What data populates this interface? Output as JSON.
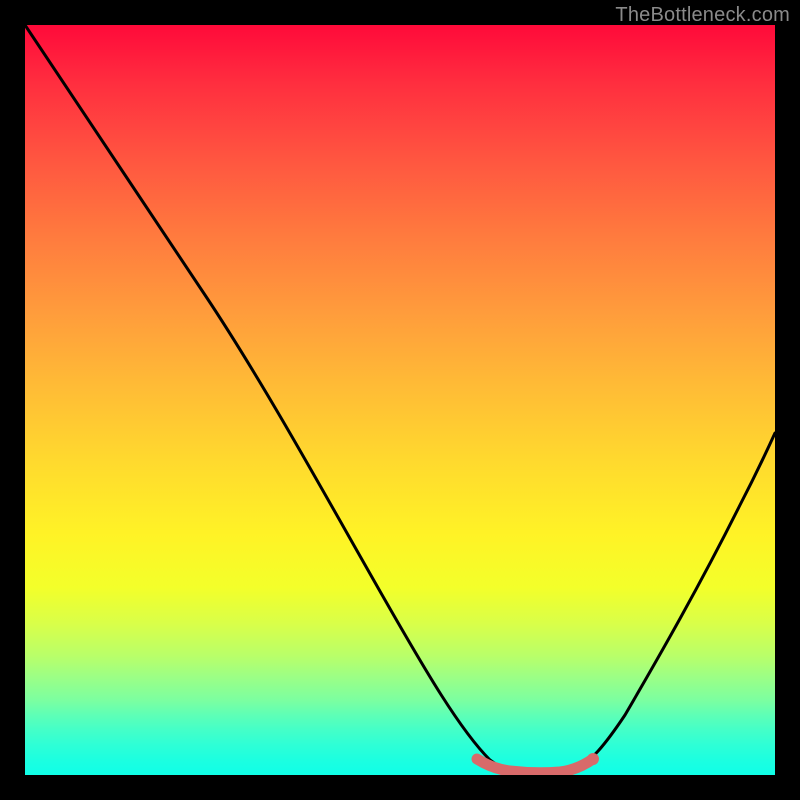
{
  "watermark": "TheBottleneck.com",
  "chart_data": {
    "type": "line",
    "title": "",
    "xlabel": "",
    "ylabel": "",
    "xlim": [
      0,
      100
    ],
    "ylim": [
      0,
      100
    ],
    "background_gradient": {
      "top": "#ff0a3a",
      "bottom": "#10ffe8",
      "stops": [
        "red",
        "orange",
        "yellow",
        "green",
        "cyan"
      ]
    },
    "series": [
      {
        "name": "bottleneck-curve",
        "color": "#000000",
        "x": [
          0,
          5,
          10,
          15,
          20,
          25,
          30,
          35,
          40,
          45,
          50,
          55,
          60,
          63,
          67,
          70,
          73,
          76,
          80,
          85,
          90,
          95,
          100
        ],
        "values": [
          100,
          92,
          83,
          74,
          66,
          57,
          48,
          40,
          32,
          24,
          17,
          10,
          4,
          1.5,
          0.5,
          0.5,
          0.5,
          1.5,
          5,
          14,
          26,
          41,
          58
        ]
      },
      {
        "name": "optimal-range-marker",
        "color": "#d86a6a",
        "x": [
          60,
          62,
          64,
          66,
          68,
          70,
          72,
          74,
          76
        ],
        "values": [
          2.0,
          1.0,
          0.7,
          0.6,
          0.6,
          0.6,
          0.7,
          1.0,
          2.0
        ]
      }
    ],
    "annotations": []
  }
}
